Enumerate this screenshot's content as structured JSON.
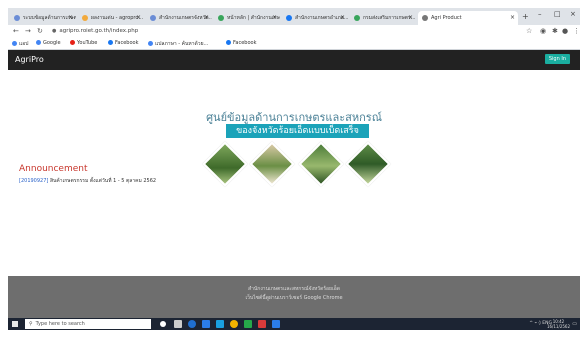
{
  "browser": {
    "tabs": [
      {
        "title": "ระบบข้อมูลด้านการเกษตรและ...",
        "active": false
      },
      {
        "title": "ผลงานเด่น - agropro...",
        "active": false
      },
      {
        "title": "สำนักงานเกษตรจังหวัด...",
        "active": false
      },
      {
        "title": "หน้าหลัก | สำนักงานเกษตร...",
        "active": false
      },
      {
        "title": "สำนักงานเกษตรอำเภอ...",
        "active": false
      },
      {
        "title": "กรมส่งเสริมการเกษตร...",
        "active": false
      },
      {
        "title": "Agri Product",
        "active": true
      }
    ],
    "new_tab_symbol": "+",
    "close_symbol": "×",
    "window_controls": {
      "minimize": "–",
      "maximize": "□",
      "close": "×"
    },
    "url": "agripro.roiet.go.th/index.php",
    "bookmarks": [
      {
        "label": "แอป",
        "color": "#4285f4"
      },
      {
        "label": "Google",
        "color": "#4285f4"
      },
      {
        "label": "YouTube",
        "color": "#e62117"
      },
      {
        "label": "Facebook",
        "color": "#1877f2"
      },
      {
        "label": "แปลภาษา - ค้นหาด้วย...",
        "color": "#4285f4"
      },
      {
        "label": "Facebook",
        "color": "#1877f2"
      }
    ]
  },
  "site": {
    "brand": "AgriPro",
    "signin": "Sign In",
    "hero_title": "ศูนย์ข้อมูลด้านการเกษตรและสหกรณ์",
    "hero_subtitle": "ของจังหวัดร้อยเอ็ดแบบเบ็ดเสร็จ",
    "announcement": {
      "heading": "Announcement",
      "date": "[20190927]",
      "text": "สินค้าเกษตรกรรม ตั้งแต่วันที่ 1 - 5 ตุลาคม 2562"
    },
    "footer": {
      "line1": "สำนักงานเกษตรและสหกรณ์จังหวัดร้อยเอ็ด",
      "line2": "เว็บไซต์นี้ดูผ่านเบราว์เซอร์ Google Chrome"
    }
  },
  "taskbar": {
    "search_placeholder": "Type here to search",
    "tray_text": "ENG",
    "time": "10:42",
    "date": "16/11/2562",
    "icon_colors": [
      "#ffffff",
      "#cccccc",
      "#1f6fd1",
      "#2b7de9",
      "#1aa0e0",
      "#f2b400",
      "#26a84a",
      "#d83b3b",
      "#2b7de9"
    ]
  }
}
